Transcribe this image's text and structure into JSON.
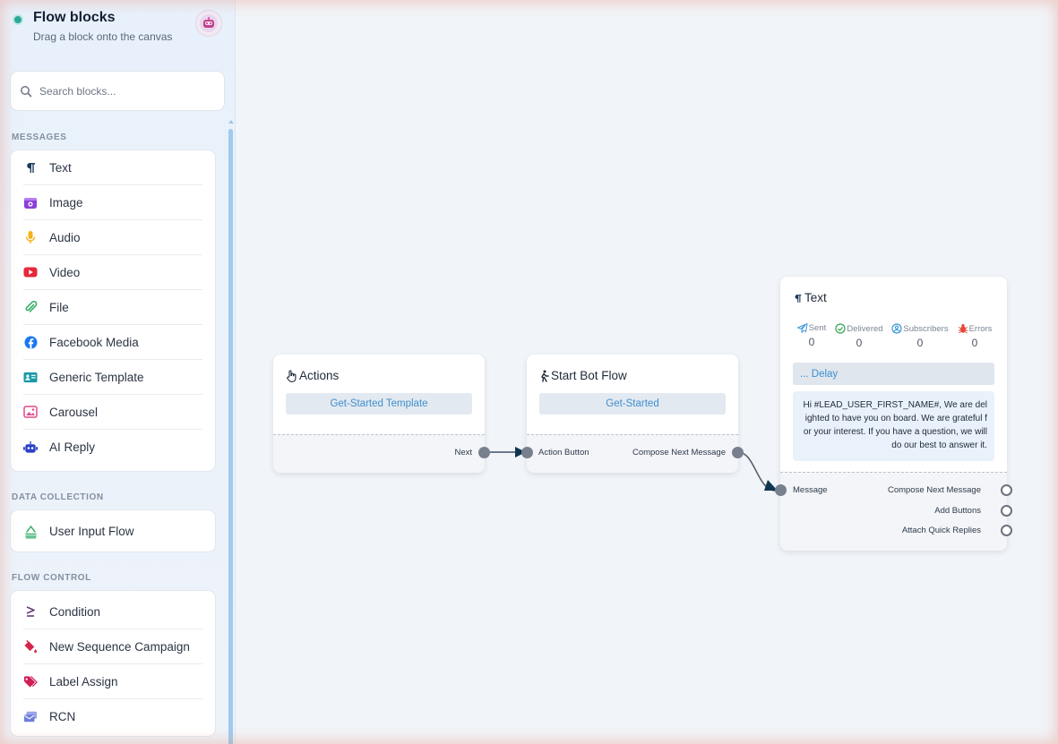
{
  "sidebar": {
    "title": "Flow blocks",
    "subtitle": "Drag a block onto the canvas",
    "search_placeholder": "Search blocks...",
    "sections": {
      "messages": {
        "label": "MESSAGES",
        "items": [
          "Text",
          "Image",
          "Audio",
          "Video",
          "File",
          "Facebook Media",
          "Generic Template",
          "Carousel",
          "AI Reply"
        ]
      },
      "data_collection": {
        "label": "DATA COLLECTION",
        "items": [
          "User Input Flow"
        ]
      },
      "flow_control": {
        "label": "FLOW CONTROL",
        "items": [
          "Condition",
          "New Sequence Campaign",
          "Label Assign",
          "RCN"
        ]
      }
    }
  },
  "canvas": {
    "actions_node": {
      "title": "Actions",
      "button": "Get-Started Template",
      "out_port": "Next"
    },
    "start_node": {
      "title": "Start Bot Flow",
      "button": "Get-Started",
      "in_port": "Action Button",
      "out_port": "Compose Next Message"
    },
    "text_node": {
      "title": "Text",
      "stats": [
        {
          "label": "Sent",
          "value": "0"
        },
        {
          "label": "Delivered",
          "value": "0"
        },
        {
          "label": "Subscribers",
          "value": "0"
        },
        {
          "label": "Errors",
          "value": "0"
        }
      ],
      "delay": "... Delay",
      "message": "Hi #LEAD_USER_FIRST_NAME#, We are delighted to have you on board. We are grateful for your interest. If you have a question, we will do our best to answer it.",
      "in_port": "Message",
      "out_ports": [
        "Compose Next Message",
        "Add Buttons",
        "Attach Quick Replies"
      ]
    }
  },
  "colors": {
    "accent_blue": "#3f8fd0",
    "status_green": "#2aa89a",
    "port_gray": "#78808e"
  }
}
